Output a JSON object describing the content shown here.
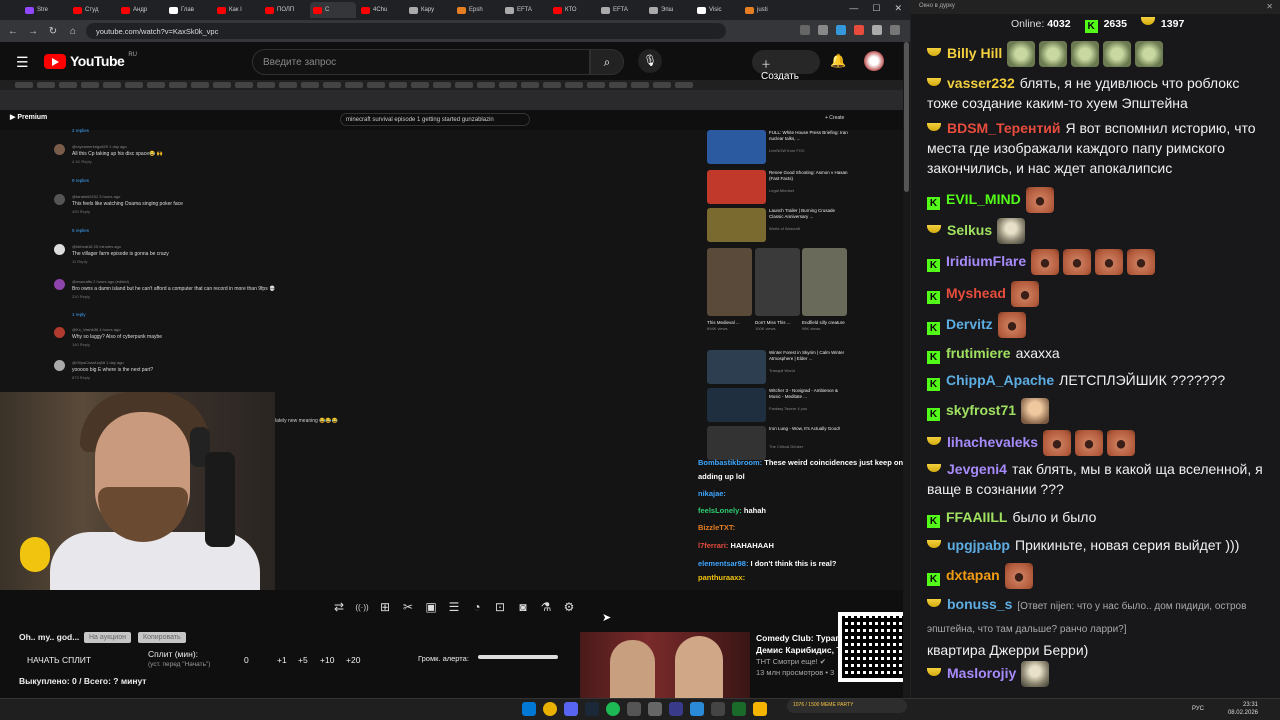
{
  "browser": {
    "tabs": [
      {
        "label": "Stre",
        "color": "#9146ff"
      },
      {
        "label": "Студ",
        "color": "#ff0000"
      },
      {
        "label": "Андр",
        "color": "#ff0000"
      },
      {
        "label": "Глав",
        "color": "#ffffff"
      },
      {
        "label": "Как I",
        "color": "#ff0000"
      },
      {
        "label": "ПОЛП",
        "color": "#ff0000"
      },
      {
        "label": "С",
        "color": "#ff0000",
        "active": true
      },
      {
        "label": "4Chu",
        "color": "#ff0000"
      },
      {
        "label": "Кару",
        "color": "#aaaaaa"
      },
      {
        "label": "Epsh",
        "color": "#e67e22"
      },
      {
        "label": "EFTA",
        "color": "#aaaaaa"
      },
      {
        "label": "КТО",
        "color": "#ff0000"
      },
      {
        "label": "EFTA",
        "color": "#aaaaaa"
      },
      {
        "label": "Эпш",
        "color": "#aaaaaa"
      },
      {
        "label": "Visic",
        "color": "#ffffff"
      },
      {
        "label": "justi",
        "color": "#e67e22"
      }
    ],
    "url": "youtube.com/watch?v=KaxSk0k_vpc"
  },
  "youtube": {
    "logo": "YouTube",
    "region": "RU",
    "search_placeholder": "Введите запрос",
    "create_label": "Создать"
  },
  "inner": {
    "premium": "Premium",
    "search_query": "minecraft survival episode 1 getting started gunzablazin",
    "create": "+ Create",
    "comments": [
      {
        "user": "@raycamerkrigo829 1 day ago",
        "text": "All this Cp taking up his disc space😂 🙌",
        "meta": "4.1K   Reply",
        "color": "#7a5c4a"
      },
      {
        "user": "@tarakeit2431 3 hours ago",
        "text": "This feels like watching Osama singing poker face",
        "meta": "420   Reply",
        "color": "#555"
      },
      {
        "user": "@kbheat18 25 minutes ago",
        "text": "The villager farm episode is gonna be crazy",
        "meta": "11   Reply",
        "color": "#ddd"
      },
      {
        "user": "@mwcrafts 2 hours ago (edited)",
        "text": "Bro owns a damn island but he can't afford a computer that can record in more than 9fps 💀",
        "meta": "210   Reply",
        "color": "#8e44ad"
      },
      {
        "user": "@Kx_Vashk36 4 hours ago",
        "text": "Why so laggy? Also of cyberpunk maybe",
        "meta": "140   Reply",
        "color": "#b03a2e"
      },
      {
        "user": "@OliyaChaaf-tq6tt 1 day ago",
        "text": "yooooo big E where is the next part?",
        "meta": "873   Reply",
        "color": "#aaa"
      }
    ],
    "replies": [
      "2 replies",
      "9 replies",
      "5 replies",
      "1 reply"
    ],
    "extra_comment": "lately new meaning 😂😂😂",
    "side_videos": [
      {
        "title": "FULL: White House Press Briefing: Iran nuclear talks, ...",
        "meta": "LiveNOW from FOX",
        "color": "#2c5aa0"
      },
      {
        "title": "Renee Good Shooting: Asmon v Hasan (Fast Facts)",
        "meta": "Legal Mindset",
        "color": "#c0392b"
      },
      {
        "title": "Launch Trailer | Burning Crusade Classic Anniversary ...",
        "meta": "World of Warcraft",
        "color": "#7a6a30"
      },
      {
        "title": "Winter Forest in Skyrim | Calm Winter Atmosphere | Elder ...",
        "meta": "Tranquil World",
        "color": "#2c3e50"
      },
      {
        "title": "Witcher 3 - Novigrad - Ambience & Music - Meditate ...",
        "meta": "Fantasy Tavern 4 you",
        "color": "#1f2f40"
      },
      {
        "title": "Iron Lung - Wow, It's Actually Good!",
        "meta": "The Critical Drinker",
        "color": "#333"
      }
    ],
    "shorts": [
      {
        "title": "This Medieval ...",
        "meta": "694K views",
        "color": "#5a4a3a"
      },
      {
        "title": "Don't Miss This ...",
        "meta": "100K views",
        "color": "#3a3a3a"
      },
      {
        "title": "Endfield silly creature",
        "meta": "98K views",
        "color": "#6a6a5a"
      }
    ]
  },
  "overlay_chat": [
    {
      "user": "Bombastikbroom:",
      "text": "These weird coincidences just keep on",
      "color": "#3ea6ff"
    },
    {
      "user": "",
      "text": "adding up lol",
      "color": "#ffffff"
    },
    {
      "user": "nikajae:",
      "text": "",
      "color": "#3ea6ff"
    },
    {
      "user": "feelsLonely:",
      "text": "hahah",
      "color": "#2ecc71"
    },
    {
      "user": "BizzleTXT:",
      "text": "",
      "color": "#e67e22"
    },
    {
      "user": "l7ferrari:",
      "text": "HAHAHAAH",
      "color": "#e74c3c"
    },
    {
      "user": "elementsar98:",
      "text": "I don't think this is real?",
      "color": "#3ea6ff"
    },
    {
      "user": "panthuraaxx:",
      "text": "",
      "color": "#f1c40f"
    }
  ],
  "toolbar_icons": [
    "loop-icon",
    "broadcast-icon",
    "add-to-queue-icon",
    "clip-icon",
    "pip-icon",
    "subtitles-icon",
    "speed-icon",
    "screenshot-icon",
    "camera-icon",
    "lab-icon",
    "settings-icon"
  ],
  "panel": {
    "title": "Oh.. my.. god...",
    "btn_split": "На аукцион",
    "btn_copy": "Копировать",
    "start_split": "НАЧАТЬ СПЛИТ",
    "split_label": "Сплит (мин):",
    "split_hint": "(уст. перед \"Начать\")",
    "values": [
      "0",
      "+1",
      "+5",
      "+10",
      "+20"
    ],
    "alert_volume": "Громк. алерта:",
    "bought": "Выкуплено: 0 / Всего: ? минут"
  },
  "recommendation": {
    "title": "Comedy Club: Турагент",
    "subtitle": "Демис Карибидис, Тим",
    "channel": "ТНТ Смотри еще! ✔",
    "views": "13 млн просмотров • 3"
  },
  "meme_party": "1076 / 1500 MEME PARTY",
  "chat": {
    "caption": "Окно в дурку",
    "online_label": "Online:",
    "online": "4032",
    "kick_viewers": "2635",
    "other_viewers": "1397",
    "messages": [
      {
        "platform": "bowl",
        "user": "Billy Hill",
        "color": "#f4d03f",
        "text": "",
        "emotes": [
          "em4",
          "em4",
          "em4",
          "em4",
          "em4"
        ]
      },
      {
        "platform": "bowl",
        "user": "vasser232",
        "color": "#f4d03f",
        "text": "блять, я не удивлюсь что роблокс тоже создание каким-то хуем Эпштейна",
        "emotes": []
      },
      {
        "platform": "bowl",
        "user": "BDSM_Терентий",
        "color": "#e74c3c",
        "text": "Я вот вспомнил историю, что места где изображали каждого папу римского закончились, и нас ждет апокалипсис",
        "emotes": []
      },
      {
        "platform": "kick",
        "user": "EVIL_MIND",
        "color": "#53fc18",
        "text": "",
        "emotes": [
          "em"
        ]
      },
      {
        "platform": "bowl",
        "user": "Selkus",
        "color": "#a0e060",
        "text": "",
        "emotes": [
          "em2"
        ]
      },
      {
        "platform": "kick",
        "user": "IridiumFlare",
        "color": "#a78bfa",
        "text": "",
        "emotes": [
          "em",
          "em",
          "em",
          "em"
        ]
      },
      {
        "platform": "kick",
        "user": "Myshead",
        "color": "#e74c3c",
        "text": "",
        "emotes": [
          "em"
        ]
      },
      {
        "platform": "kick",
        "user": "Dervitz",
        "color": "#5dade2",
        "text": "",
        "emotes": [
          "em"
        ]
      },
      {
        "platform": "kick",
        "user": "frutimiere",
        "color": "#a0e060",
        "text": "ахахха",
        "emotes": []
      },
      {
        "platform": "kick",
        "user": "ChippA_Apache",
        "color": "#5dade2",
        "text": "ЛЕТСПЛЭЙШИК ???????",
        "emotes": []
      },
      {
        "platform": "kick",
        "user": "skyfrost71",
        "color": "#a0e060",
        "text": "",
        "emotes": [
          "em3"
        ]
      },
      {
        "platform": "bowl",
        "user": "lihachevaleks",
        "color": "#a78bfa",
        "text": "",
        "emotes": [
          "em",
          "em",
          "em"
        ]
      },
      {
        "platform": "bowl",
        "user": "Jevgeni4",
        "color": "#a78bfa",
        "text": "так блять, мы в какой ща вселенной, я ваще в сознании ???",
        "emotes": []
      },
      {
        "platform": "kick",
        "user": "FFAAIILL",
        "color": "#a0e060",
        "text": "было и было",
        "emotes": []
      },
      {
        "platform": "bowl",
        "user": "upgjpabp",
        "color": "#5dade2",
        "text": "Прикиньте, новая серия выйдет )))",
        "emotes": []
      },
      {
        "platform": "kick",
        "user": "dxtapan",
        "color": "#f39c12",
        "text": "",
        "emotes": [
          "em"
        ]
      },
      {
        "platform": "bowl",
        "user": "bonuss_s",
        "color": "#5dade2",
        "text": "",
        "reply": "[Ответ nijen: что у нас было.. дом пидиди, остров эпштейна, что там дальше? ранчо ларри?]",
        "text2": "квартира Джерри Берри)",
        "emotes": []
      },
      {
        "platform": "bowl",
        "user": "Maslorojiy",
        "color": "#a78bfa",
        "text": "",
        "emotes": [
          "em2"
        ]
      }
    ]
  },
  "taskbar": {
    "lang": "РУС",
    "time": "23:31",
    "date": "08.02.2026"
  }
}
